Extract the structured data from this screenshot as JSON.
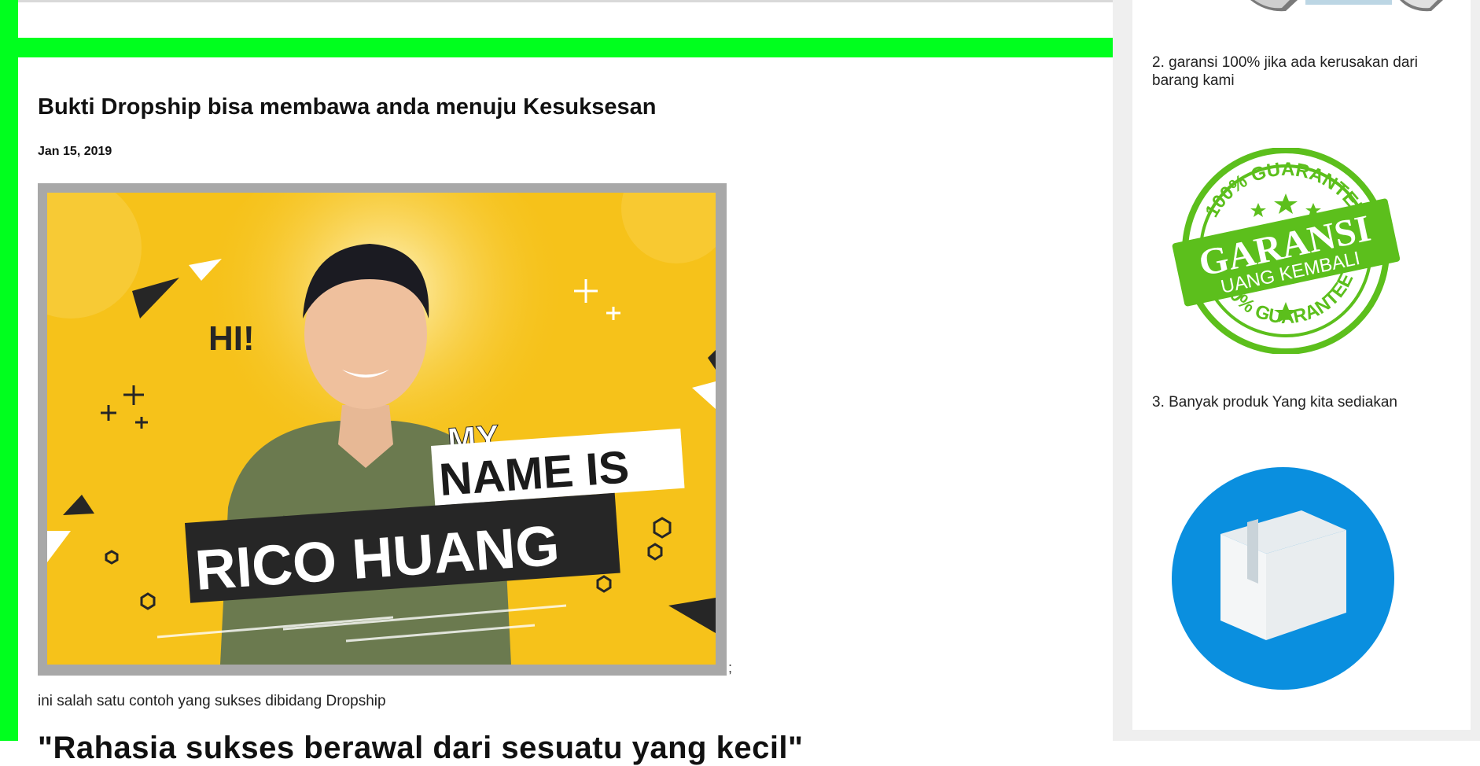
{
  "post": {
    "title": "Bukti Dropship bisa membawa anda menuju Kesuksesan",
    "date": "Jan 15, 2019",
    "thumbnail": {
      "greeting": "HI!",
      "line1": "MY",
      "line2": "NAME IS",
      "name": "RICO HUANG"
    },
    "after_image_text": ";",
    "caption": "ini salah satu contoh yang sukses dibidang Dropship",
    "next_heading_partial": "\"Rahasia sukses berawal dari sesuatu yang kecil\""
  },
  "sidebar": {
    "item2": "2. garansi 100% jika ada kerusakan dari barang kami",
    "stamp": {
      "ring_top": "100% GUARANTEE",
      "ring_bottom": "100% GUARANTEE",
      "main": "GARANSI",
      "sub": "UANG KEMBALI"
    },
    "item3": "3. Banyak produk Yang kita sediakan",
    "box_icon": "package-box-icon"
  },
  "colors": {
    "accent_green": "#00ff1e",
    "stamp_green": "#5cbf1c",
    "box_blue": "#0a8fdf",
    "thumb_yellow": "#f6c21a"
  }
}
